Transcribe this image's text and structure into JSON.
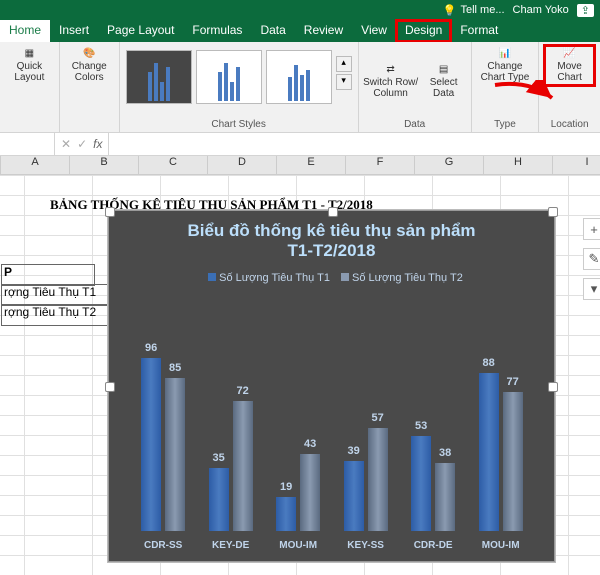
{
  "titlebar": {
    "tell_me": "Tell me...",
    "user": "Cham Yoko"
  },
  "tabs": {
    "home": "Home",
    "insert": "Insert",
    "page_layout": "Page Layout",
    "formulas": "Formulas",
    "data": "Data",
    "review": "Review",
    "view": "View",
    "design": "Design",
    "format": "Format"
  },
  "ribbon": {
    "quick_layout": "Quick\nLayout",
    "change_colors": "Change\nColors",
    "chart_styles_label": "Chart Styles",
    "switch_row_col": "Switch Row/\nColumn",
    "select_data": "Select\nData",
    "data_label": "Data",
    "change_chart_type": "Change\nChart Type",
    "type_label": "Type",
    "move_chart": "Move\nChart",
    "location_label": "Location"
  },
  "formula_bar": {
    "fx": "fx"
  },
  "columns": [
    "A",
    "B",
    "C",
    "D",
    "E",
    "F",
    "G",
    "H",
    "I"
  ],
  "cells": {
    "title": "BẢNG THỐNG KÊ TIÊU THỤ SẢN PHẨM T1 - T2/2018",
    "p_label": "P",
    "row1_label": "rợng Tiêu Thụ T1",
    "row2_label": "rợng Tiêu Thụ T2"
  },
  "chart_data": {
    "type": "bar",
    "title": "Biểu đồ thống kê tiêu thụ sản phẩm\nT1-T2/2018",
    "categories": [
      "CDR-SS",
      "KEY-DE",
      "MOU-IM",
      "KEY-SS",
      "CDR-DE",
      "MOU-IM"
    ],
    "series": [
      {
        "name": "Số Lượng Tiêu Thụ T1",
        "color": "#3b6fb5",
        "values": [
          96,
          35,
          19,
          39,
          53,
          88
        ]
      },
      {
        "name": "Số Lượng Tiêu Thụ T2",
        "color": "#8a9ab0",
        "values": [
          85,
          72,
          43,
          57,
          38,
          77
        ]
      }
    ],
    "ylim": [
      0,
      100
    ]
  },
  "side": {
    "plus": "+",
    "brush": "✎",
    "filter": "▾"
  }
}
